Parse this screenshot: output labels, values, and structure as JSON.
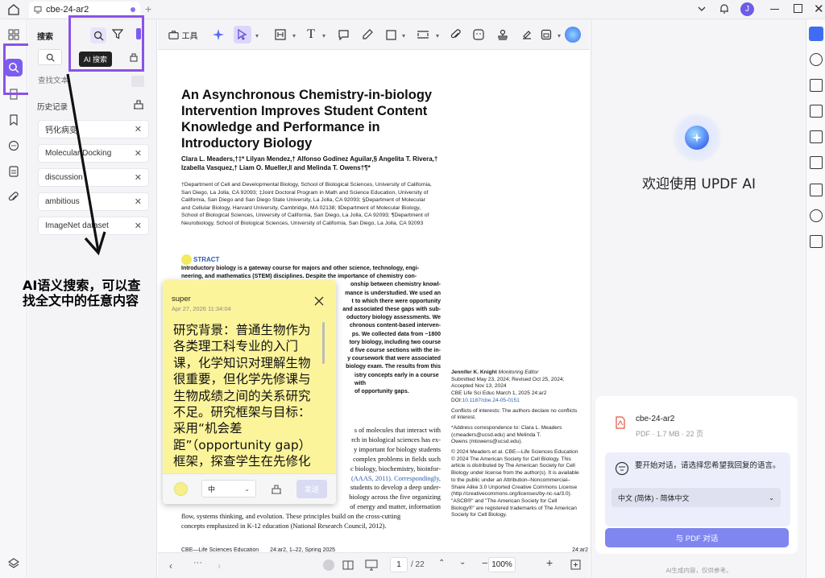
{
  "titlebar": {
    "tab_title": "cbe-24-ar2",
    "avatar_letter": "J"
  },
  "search_panel": {
    "title": "搜索",
    "tooltip": "AI 搜索",
    "placeholder": "查找文本",
    "history_label": "历史记录",
    "history_items": [
      "钙化病变",
      "Molecular Docking",
      "discussion",
      "ambitious",
      "ImageNet dataset"
    ]
  },
  "annotation": {
    "text": "AI语义搜索，可以查找全文中的任意内容"
  },
  "toolbar": {
    "tools_label": "工具"
  },
  "document": {
    "title": "An Asynchronous Chemistry-in-biology Intervention Improves Student Content Knowledge and Performance in Introductory Biology",
    "authors": "Clara L. Meaders,†‡* Lilyan Mendez,† Alfonso Godinez Aguilar,§ Angelita T. Rivera,† Izabella Vasquez,† Liam O. Mueller,‖ and Melinda T. Owens†¶*",
    "affiliations": "†Department of Cell and Developmental Biology, School of Biological Sciences, University of California, San Diego, La Jolla, CA 92093; ‡Joint Doctoral Program in Math and Science Education, University of California, San Diego and San Diego State University, La Jolla, CA 92093; §Department of Molecular and Cellular Biology, Harvard University, Cambridge, MA 02138; ‖Department of Molecular Biology, School of Biological Sciences, University of California, San Diego, La Jolla, CA 92093; ¶Department of Neurobiology, School of Biological Sciences, University of California, San Diego, La Jolla, CA 92093",
    "abstract_heading": "STRACT",
    "abstract_lines": [
      "Introductory biology is a gateway course for majors and other science, technology, engi-",
      "neering, and mathematics (STEM) disciplines. Despite the importance of chemistry con-",
      "onship between chemistry knowl-",
      "mance is understudied. We used an",
      "t to which there were opportunity",
      "and associated these gaps with sub-",
      "oductory biology assessments. We",
      "chronous content-based interven-",
      "ps. We collected data from ~1800",
      "tory biology, including two course",
      "d five course sections with the in-",
      "y coursework that were associated",
      "biology exam. The results from this",
      "istry concepts early in a course with",
      "of opportunity gaps."
    ],
    "body_lines": [
      "s of molecules that interact with",
      "rch in biological sciences has ex-",
      "y important for biology students",
      "complex problems in fields such",
      "c biology, biochemistry, bioinfor-",
      "(AAAS, 2011). Correspondingly,",
      "students to develop a deep under-",
      "biology across the five organizing",
      "of energy and matter, information",
      "flow, systems thinking, and evolution. These principles build on the cross-cutting",
      "concepts emphasized in K-12 education (National Research Council, 2012)."
    ],
    "side_editor": "Jennifer K. Knight",
    "side_editor_role": "Monitoring Editor",
    "side_dates": [
      "Submitted May 23, 2024; Revised Oct 25, 2024;",
      "Accepted Nov 13, 2024"
    ],
    "side_citation": "CBE Life Sci Educ March 1, 2025 24:ar2",
    "side_doi_label": "DOI:",
    "side_doi": "10.1187/cbe.24-05-0151",
    "side_conflicts": "Conflicts of interests: The authors declare no conflicts of interest.",
    "side_contact_lines": [
      "*Address correspondence to: Clara L. Meaders",
      "(cmeaders@ucsd.edu) and Melinda T.",
      "Owens (mtowens@ucsd.edu)."
    ],
    "side_license": "© 2024 Meaders et al. CBE—Life Sciences Education © 2024 The American Society for Cell Biology. This article is distributed by The American Society for Cell Biology under license from the author(s). It is available to the public under an Attribution–Noncommercial–Share Alike 3.0 Unported Creative Commons License (http://creativecommons.org/licenses/by-nc-sa/3.0).",
    "side_trademark": "\"ASCB®\" and \"The American Society for Cell Biology®\" are registered trademarks of The American Society for Cell Biology.",
    "footer_left": "CBE—Life Sciences Education",
    "footer_mid": "24:ar2, 1–22, Spring 2025",
    "footer_right": "24:ar2"
  },
  "note": {
    "author": "super",
    "timestamp": "Apr 27, 2026 11:34:04",
    "content": "研究背景：普通生物作为各类理工科专业的入门课，化学知识对理解生物很重要，但化学先修课与生物成绩之间的关系研究不足。研究框架与目标：采用“机会差距”（opportunity gap）框架，探查学生在先修化学课程与知识上的",
    "font_size_option": "中",
    "send_label": "发送"
  },
  "bottombar": {
    "page_current": "1",
    "page_total": "/ 22",
    "zoom": "100%"
  },
  "ai_panel": {
    "welcome": "欢迎使用 UPDF AI",
    "file_name": "cbe-24-ar2",
    "file_meta": "PDF · 1.7 MB · 22 页",
    "prompt": "要开始对话，请选择您希望我回复的语言。",
    "language": "中文 (简体) - 简体中文",
    "cta": "与 PDF 对话",
    "disclaimer": "AI生成内容，仅供参考。"
  },
  "colors": {
    "accent": "#8a52e6",
    "button": "#7f86f0",
    "note": "#fcf49a"
  }
}
